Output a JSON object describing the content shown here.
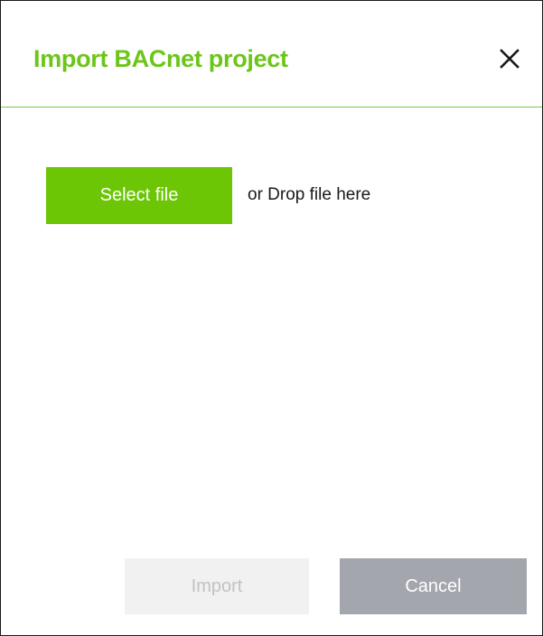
{
  "dialog": {
    "title": "Import BACnet project",
    "close_icon": "close-icon"
  },
  "upload": {
    "select_label": "Select file",
    "drop_text": "or Drop file here"
  },
  "footer": {
    "import_label": "Import",
    "import_enabled": false,
    "cancel_label": "Cancel"
  },
  "colors": {
    "accent": "#6cc519",
    "select_button": "#6cc606",
    "divider": "#7ac943",
    "import_disabled_bg": "#f1f1f1",
    "import_disabled_text": "#c2c2c2",
    "cancel_bg": "#a3a6ad"
  }
}
